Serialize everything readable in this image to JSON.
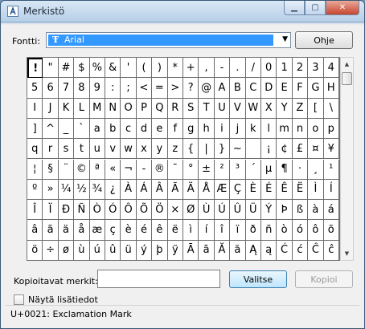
{
  "window": {
    "title": "Merkistö"
  },
  "font": {
    "label": "Fontti:",
    "value": "Arial",
    "type_glyph": "Ŧ"
  },
  "buttons": {
    "help": "Ohje",
    "select": "Valitse",
    "copy": "Kopioi"
  },
  "copy": {
    "label": "Kopioitavat merkit:",
    "value": ""
  },
  "advanced": {
    "label": "Näytä lisätiedot"
  },
  "status": {
    "text": "U+0021: Exclamation Mark"
  },
  "grid": {
    "selected_index": 0,
    "rows": [
      [
        "!",
        "\"",
        "#",
        "$",
        "%",
        "&",
        "'",
        "(",
        ")",
        "*",
        "+",
        ",",
        "-",
        ".",
        "/",
        "0",
        "1",
        "2",
        "3",
        "4"
      ],
      [
        "5",
        "6",
        "7",
        "8",
        "9",
        ":",
        ";",
        "<",
        "=",
        ">",
        "?",
        "@",
        "A",
        "B",
        "C",
        "D",
        "E",
        "F",
        "G",
        "H"
      ],
      [
        "I",
        "J",
        "K",
        "L",
        "M",
        "N",
        "O",
        "P",
        "Q",
        "R",
        "S",
        "T",
        "U",
        "V",
        "W",
        "X",
        "Y",
        "Z",
        "[",
        "\\"
      ],
      [
        "]",
        "^",
        "_",
        "`",
        "a",
        "b",
        "c",
        "d",
        "e",
        "f",
        "g",
        "h",
        "i",
        "j",
        "k",
        "l",
        "m",
        "n",
        "o",
        "p"
      ],
      [
        "q",
        "r",
        "s",
        "t",
        "u",
        "v",
        "w",
        "x",
        "y",
        "z",
        "{",
        "|",
        "}",
        "~",
        " ",
        "¡",
        "¢",
        "£",
        "¤",
        "¥"
      ],
      [
        "¦",
        "§",
        "¨",
        "©",
        "ª",
        "«",
        "¬",
        "-",
        "®",
        "¯",
        "°",
        "±",
        "²",
        "³",
        "´",
        "µ",
        "¶",
        "·",
        "¸",
        "¹"
      ],
      [
        "º",
        "»",
        "¼",
        "½",
        "¾",
        "¿",
        "À",
        "Á",
        "Â",
        "Ã",
        "Ä",
        "Å",
        "Æ",
        "Ç",
        "È",
        "É",
        "Ê",
        "Ë",
        "Ì",
        "Í"
      ],
      [
        "Î",
        "Ï",
        "Ð",
        "Ñ",
        "Ò",
        "Ó",
        "Ô",
        "Õ",
        "Ö",
        "×",
        "Ø",
        "Ù",
        "Ú",
        "Û",
        "Ü",
        "Ý",
        "Þ",
        "ß",
        "à",
        "á"
      ],
      [
        "â",
        "ã",
        "ä",
        "å",
        "æ",
        "ç",
        "è",
        "é",
        "ê",
        "ë",
        "ì",
        "í",
        "î",
        "ï",
        "ð",
        "ñ",
        "ò",
        "ó",
        "ô",
        "õ"
      ],
      [
        "ö",
        "÷",
        "ø",
        "ù",
        "ú",
        "û",
        "ü",
        "ý",
        "þ",
        "ÿ",
        "Ā",
        "ā",
        "Ă",
        "ă",
        "Ą",
        "ą",
        "Ć",
        "ć",
        "Ĉ",
        "ĉ"
      ]
    ]
  }
}
